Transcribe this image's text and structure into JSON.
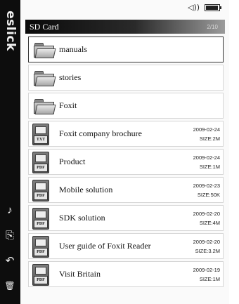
{
  "brand": "eslick",
  "status": {
    "volume_icon": "volume-icon",
    "battery_level": 0.95
  },
  "header": {
    "title": "SD Card",
    "page_indicator": "2/10"
  },
  "items": [
    {
      "type": "folder",
      "name": "manuals",
      "selected": true
    },
    {
      "type": "folder",
      "name": "stories"
    },
    {
      "type": "folder",
      "name": "Foxit"
    },
    {
      "type": "file",
      "ext": "TXT",
      "name": "Foxit company brochure",
      "date": "2009-02-24",
      "size": "SIZE:2M"
    },
    {
      "type": "file",
      "ext": "PDF",
      "name": "Product",
      "date": "2009-02-24",
      "size": "SIZE:1M"
    },
    {
      "type": "file",
      "ext": "PDF",
      "name": "Mobile solution",
      "date": "2009-02-23",
      "size": "SIZE:50K"
    },
    {
      "type": "file",
      "ext": "PDF",
      "name": "SDK solution",
      "date": "2009-02-20",
      "size": "SIZE:4M"
    },
    {
      "type": "file",
      "ext": "PDF",
      "name": "User guide of Foxit Reader",
      "date": "2009-02-20",
      "size": "SIZE:3.2M"
    },
    {
      "type": "file",
      "ext": "PDF",
      "name": "Visit Britain",
      "date": "2009-02-19",
      "size": "SIZE:1M"
    }
  ],
  "side_buttons": [
    {
      "icon": "music-note-icon",
      "glyph": "♪"
    },
    {
      "icon": "bookmark-icon",
      "glyph": "⎘"
    },
    {
      "icon": "back-arrow-icon",
      "glyph": "↶"
    },
    {
      "icon": "trash-icon",
      "glyph": "🗑"
    }
  ]
}
